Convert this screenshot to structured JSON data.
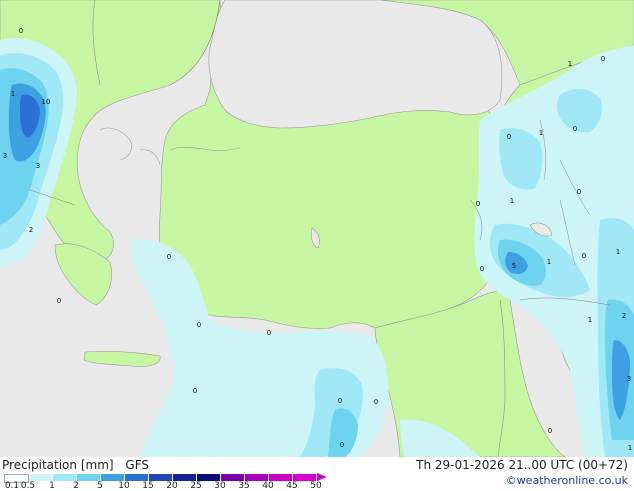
{
  "map": {
    "colors": {
      "sea": "#e9e9e9",
      "land": "#c7f6a2",
      "precip_1": "#cdf5f8",
      "precip_2": "#a0e8f5",
      "precip_3": "#6ed3ef",
      "precip_4": "#3da0e0",
      "precip_5": "#2a6fd4"
    },
    "value_labels": [
      {
        "text": "0"
      },
      {
        "text": "1"
      },
      {
        "text": "10"
      },
      {
        "text": "3"
      },
      {
        "text": "3"
      },
      {
        "text": "2"
      },
      {
        "text": "0"
      },
      {
        "text": "0"
      },
      {
        "text": "0"
      },
      {
        "text": "0"
      },
      {
        "text": "0"
      },
      {
        "text": "0"
      },
      {
        "text": "0"
      },
      {
        "text": "0"
      },
      {
        "text": "1"
      },
      {
        "text": "0"
      },
      {
        "text": "0"
      },
      {
        "text": "1"
      },
      {
        "text": "0"
      },
      {
        "text": "0"
      },
      {
        "text": "1"
      },
      {
        "text": "0"
      },
      {
        "text": "0"
      },
      {
        "text": "5"
      },
      {
        "text": "1"
      },
      {
        "text": "0"
      },
      {
        "text": "1"
      },
      {
        "text": "1"
      },
      {
        "text": "2"
      },
      {
        "text": "3"
      },
      {
        "text": "1"
      },
      {
        "text": "0"
      }
    ]
  },
  "legend": {
    "title": "Precipitation [mm]",
    "model": "GFS",
    "datetime": "Th 29-01-2026 21..00 UTC (00+72)",
    "credit": "©weatheronline.co.uk",
    "scale_colors": [
      "#f5fdfd",
      "#cdf5f8",
      "#a0e8f5",
      "#6ed3ef",
      "#3da0e0",
      "#2a6fd4",
      "#2047b8",
      "#16219a",
      "#0c0c78",
      "#7a00a8",
      "#a800c0",
      "#c800c8",
      "#d800d8"
    ],
    "tick_labels": [
      "0.1",
      "0.5",
      "1",
      "2",
      "5",
      "10",
      "15",
      "20",
      "25",
      "30",
      "35",
      "40",
      "45",
      "50"
    ]
  }
}
